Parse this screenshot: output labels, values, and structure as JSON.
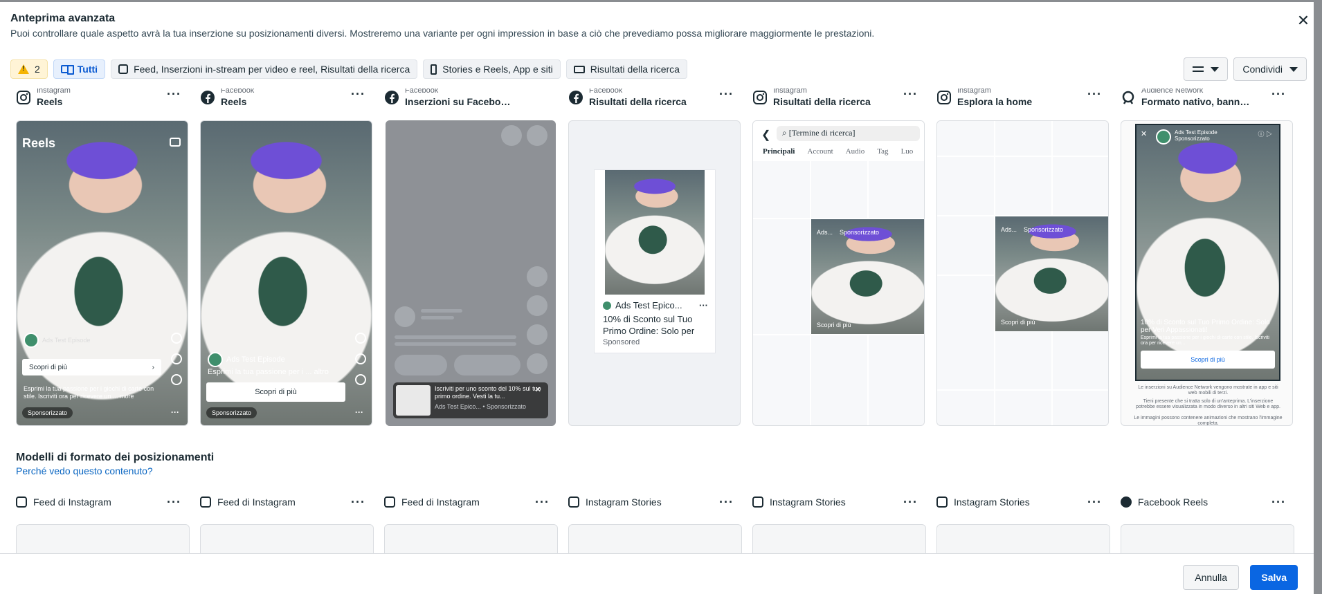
{
  "dialog": {
    "title": "Anteprima avanzata",
    "subtitle": "Puoi controllare quale aspetto avrà la tua inserzione su posizionamenti diversi. Mostreremo una variante per ogni impression in base a ciò che prevediamo possa migliorare maggiormente le prestazioni.",
    "close_icon": "close-icon"
  },
  "filters": {
    "warning_count": "2",
    "all": "Tutti",
    "feed": "Feed, Inserzioni in-stream per video e reel, Risultati della ricerca",
    "stories": "Stories e Reels, App e siti",
    "search": "Risultati della ricerca"
  },
  "toolbar": {
    "share": "Condividi"
  },
  "placements": [
    {
      "platform": "Instagram",
      "name": "Reels"
    },
    {
      "platform": "Facebook",
      "name": "Reels"
    },
    {
      "platform": "Facebook",
      "name": "Inserzioni su Facebook ..."
    },
    {
      "platform": "Facebook",
      "name": "Risultati della ricerca"
    },
    {
      "platform": "Instagram",
      "name": "Risultati della ricerca"
    },
    {
      "platform": "Instagram",
      "name": "Esplora la home"
    },
    {
      "platform": "Audience Network",
      "name": "Formato nativo, banner ..."
    }
  ],
  "ig_reels": {
    "label": "Reels",
    "account": "Ads Test Episode",
    "cta": "Scopri di più",
    "text": "Esprimi la tua passione per i giochi di carte con stile. Iscriviti ora per ricevere un ... more",
    "sponsored": "Sponsorizzato"
  },
  "fb_reels": {
    "account": "Ads Test Episode",
    "text": "Esprimi la tua passione per i ... altro",
    "cta": "Scopri di più",
    "sponsored": "Sponsorizzato"
  },
  "fb_stories": {
    "text": "Iscriviti per uno sconto del 10% sul tuo primo ordine. Vesti la tu...",
    "meta": "Ads Test Epico... • Sponsorizzato"
  },
  "fb_search": {
    "account": "Ads Test Epico...",
    "text": "10% di Sconto sul Tuo Primo Ordine: Solo per",
    "sponsored": "Sponsored"
  },
  "ig_search": {
    "query": "[Termine di ricerca]",
    "tabs": [
      "Principali",
      "Account",
      "Audio",
      "Tag",
      "Luo"
    ],
    "tile_account": "Ads...",
    "tile_sponsored": "Sponsorizzato",
    "tile_cta": "Scopri di più"
  },
  "ig_explore": {
    "tile_account": "Ads...",
    "tile_sponsored": "Sponsorizzato",
    "tile_cta": "Scopri di più"
  },
  "audience_network": {
    "account": "Ads Test Episode",
    "sponsored": "Sponsorizzato",
    "headline": "10% di Sconto sul Tuo Primo Ordine: Solo per Veri Appassionati!",
    "body": "Esprimi la tua passione per i giochi di carte con stile. Iscriviti ora per ricevere un...",
    "cta": "Scopri di più",
    "note1": "Le inserzioni su Audience Network vengono mostrate in app e siti web mobili di terzi.",
    "note2": "Tieni presente che si tratta solo di un'anteprima. L'inserzione potrebbe essere visualizzata in modo diverso in altri siti Web e app.",
    "note3": "Le immagini possono contenere animazioni che mostrano l'immagine completa."
  },
  "templates_section": {
    "title": "Modelli di formato dei posizionamenti",
    "link": "Perché vedo questo contenuto?",
    "items": [
      {
        "name": "Feed di Instagram",
        "icon": "instagram-icon"
      },
      {
        "name": "Feed di Instagram",
        "icon": "instagram-icon"
      },
      {
        "name": "Feed di Instagram",
        "icon": "instagram-icon"
      },
      {
        "name": "Instagram Stories",
        "icon": "instagram-icon"
      },
      {
        "name": "Instagram Stories",
        "icon": "instagram-icon"
      },
      {
        "name": "Instagram Stories",
        "icon": "instagram-icon"
      },
      {
        "name": "Facebook Reels",
        "icon": "facebook-icon"
      }
    ]
  },
  "footer": {
    "cancel": "Annulla",
    "save": "Salva"
  },
  "colors": {
    "primary": "#0a66e2",
    "link": "#0a66c2",
    "warning": "#f5b400",
    "text": "#1c2b33"
  }
}
